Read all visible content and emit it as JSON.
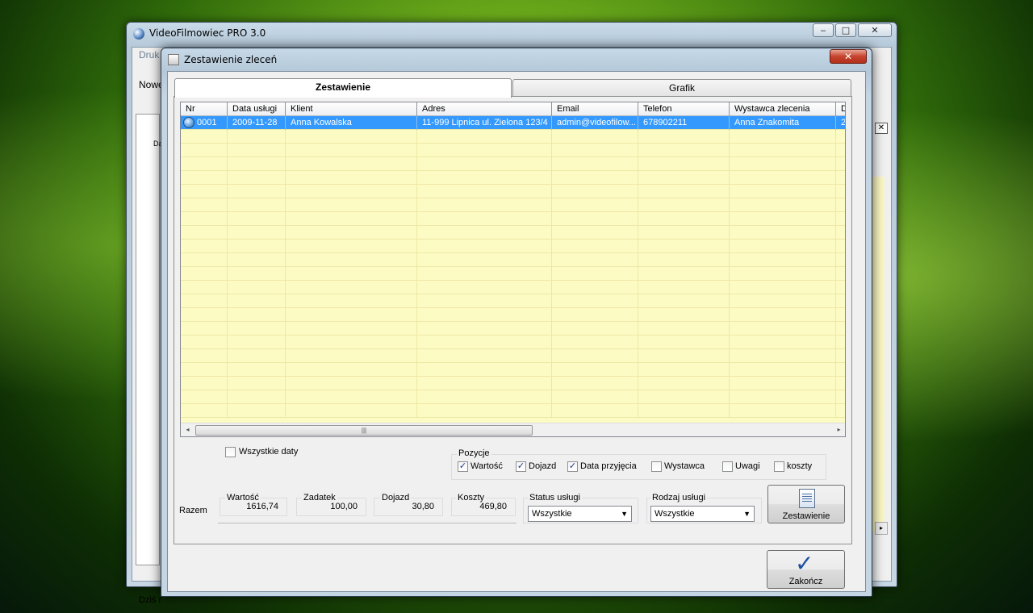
{
  "app": {
    "title": "VideoFilmowiec  PRO 3.0",
    "menu_partial": "Druk",
    "toolbar_partial": "Nowe",
    "list_header_partial": "Da",
    "status_partial": "Dziś r",
    "caption_buttons": {
      "minimize": "‒",
      "maximize": "□",
      "close": "✕"
    },
    "panel_close": "✕"
  },
  "dialog": {
    "title": "Zestawienie zleceń",
    "close": "✕",
    "tabs": [
      {
        "label": "Zestawienie",
        "active": true
      },
      {
        "label": "Grafik",
        "active": false
      }
    ],
    "grid": {
      "columns": [
        "Nr",
        "Data usługi",
        "Klient",
        "Adres",
        "Email",
        "Telefon",
        "Wystawca zlecenia",
        "D"
      ],
      "rows": [
        [
          "0001",
          "2009-11-28",
          "Anna Kowalska",
          "11-999 Lipnica ul. Zielona 123/4",
          "admin@videofilow...",
          "678902211",
          "Anna Znakomita",
          "2"
        ]
      ],
      "empty_rows": 21,
      "scroll_grip": "|||"
    },
    "filters": {
      "all_dates": {
        "label": "Wszystkie daty",
        "checked": false
      }
    },
    "pozycje": {
      "title": "Pozycje",
      "items": [
        {
          "label": "Wartość",
          "checked": true
        },
        {
          "label": "Dojazd",
          "checked": true
        },
        {
          "label": "Data przyjęcia",
          "checked": true
        },
        {
          "label": "Wystawca",
          "checked": false
        },
        {
          "label": "Uwagi",
          "checked": false
        },
        {
          "label": "koszty",
          "checked": false
        }
      ]
    },
    "totals": {
      "row_label": "Razem",
      "wartosc": {
        "label": "Wartość",
        "value": "1616,74"
      },
      "zadatek": {
        "label": "Zadatek",
        "value": "100,00"
      },
      "dojazd": {
        "label": "Dojazd",
        "value": "30,80"
      },
      "koszty": {
        "label": "Koszty",
        "value": "469,80"
      }
    },
    "status": {
      "label": "Status usługi",
      "value": "Wszystkie"
    },
    "rodzaj": {
      "label": "Rodzaj usługi",
      "value": "Wszystkie"
    },
    "buttons": {
      "report": "Zestawienie",
      "finish": "Zakończ"
    },
    "check_glyph": "✓",
    "combo_arrow": "▼"
  }
}
